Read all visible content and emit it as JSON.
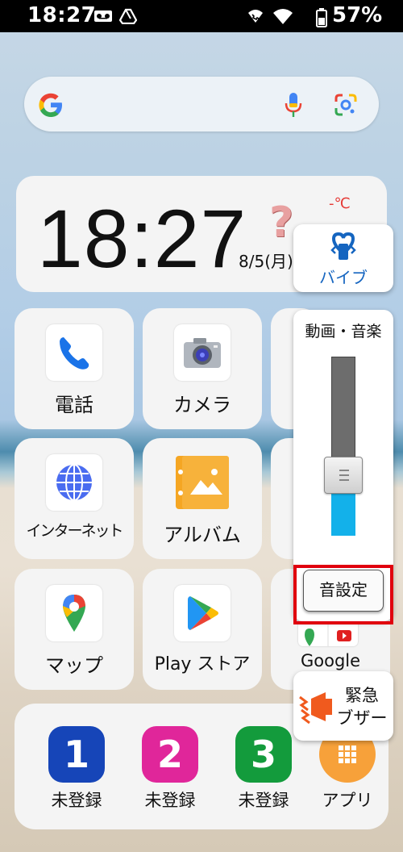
{
  "status_bar": {
    "time": "18:27",
    "battery_percent": "57%",
    "icons": [
      "voicemail-icon",
      "drive-icon",
      "wifi-calling-icon",
      "wifi-icon",
      "battery-icon"
    ]
  },
  "search_bar": {
    "icons": [
      "google-logo-icon",
      "microphone-icon",
      "google-lens-icon"
    ]
  },
  "clock_widget": {
    "time": "18:27",
    "date": "8/5(月)",
    "temperature": "-℃",
    "weather_icon": "unknown-weather-question-icon"
  },
  "apps": [
    {
      "label": "電話",
      "icon": "phone-icon"
    },
    {
      "label": "カメラ",
      "icon": "camera-icon"
    },
    {
      "label": "インターネット",
      "icon": "globe-icon"
    },
    {
      "label": "アルバム",
      "icon": "album-icon"
    },
    {
      "label": "マップ",
      "icon": "google-maps-icon"
    },
    {
      "label": "Play ストア",
      "icon": "play-store-icon"
    },
    {
      "label": "Google",
      "icon": "google-folder-icon"
    }
  ],
  "dock": [
    {
      "number": "1",
      "label": "未登録",
      "color": "#1645b8"
    },
    {
      "number": "2",
      "label": "未登録",
      "color": "#e0269a"
    },
    {
      "number": "3",
      "label": "未登録",
      "color": "#139b3c"
    },
    {
      "label": "アプリ",
      "color": "#f7a13a",
      "icon": "app-grid-icon"
    }
  ],
  "volume_panel": {
    "vibrate_label": "バイブ",
    "stream_label": "動画・音楽",
    "level": 0.29,
    "sound_settings_label": "音設定",
    "accent_color": "#13b1ea"
  },
  "buzzer": {
    "label_line1": "緊急",
    "label_line2": "ブザー",
    "icon": "buzzer-icon"
  },
  "highlight_color": "#e0000e"
}
